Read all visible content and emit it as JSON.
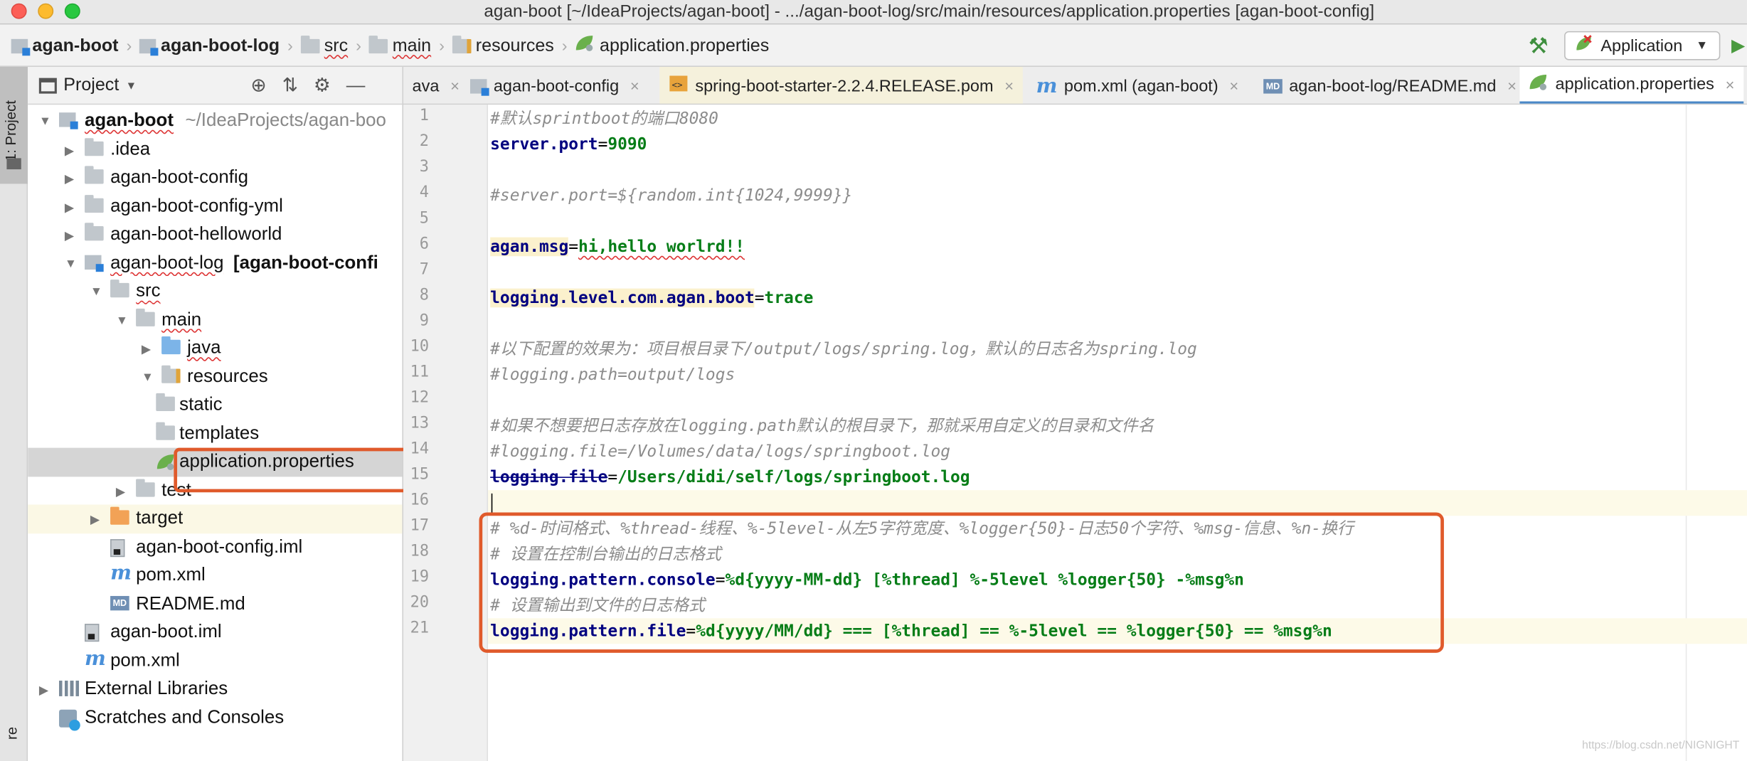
{
  "window": {
    "title": "agan-boot [~/IdeaProjects/agan-boot] - .../agan-boot-log/src/main/resources/application.properties [agan-boot-config]"
  },
  "breadcrumb": [
    {
      "label": "agan-boot",
      "icon": "module-icon"
    },
    {
      "label": "agan-boot-log",
      "icon": "module-icon"
    },
    {
      "label": "src",
      "icon": "folder-icon"
    },
    {
      "label": "main",
      "icon": "folder-icon"
    },
    {
      "label": "resources",
      "icon": "resources-folder-icon"
    },
    {
      "label": "application.properties",
      "icon": "spring-leaf-icon"
    }
  ],
  "toolbar": {
    "run_config_label": "Application"
  },
  "toolstrip": {
    "project_tab_label": "1: Project",
    "bottom_label": "re"
  },
  "project_panel": {
    "title": "Project",
    "tree": [
      {
        "label": "agan-boot",
        "suffix": "~/IdeaProjects/agan-boo",
        "depth": 0,
        "icon": "module-icon",
        "arrow": "down"
      },
      {
        "label": ".idea",
        "depth": 1,
        "icon": "folder-icon",
        "arrow": "right"
      },
      {
        "label": "agan-boot-config",
        "depth": 1,
        "icon": "folder-icon",
        "arrow": "right"
      },
      {
        "label": "agan-boot-config-yml",
        "depth": 1,
        "icon": "folder-icon",
        "arrow": "right"
      },
      {
        "label": "agan-boot-helloworld",
        "depth": 1,
        "icon": "folder-icon",
        "arrow": "right"
      },
      {
        "label": "agan-boot-log",
        "suffix": "[agan-boot-confi",
        "depth": 1,
        "icon": "module-icon",
        "arrow": "down"
      },
      {
        "label": "src",
        "depth": 2,
        "icon": "folder-icon",
        "arrow": "down"
      },
      {
        "label": "main",
        "depth": 3,
        "icon": "folder-icon",
        "arrow": "down"
      },
      {
        "label": "java",
        "depth": 4,
        "icon": "source-folder-icon",
        "arrow": "right"
      },
      {
        "label": "resources",
        "depth": 4,
        "icon": "resources-folder-icon",
        "arrow": "down"
      },
      {
        "label": "static",
        "depth": 5,
        "icon": "folder-icon",
        "arrow": ""
      },
      {
        "label": "templates",
        "depth": 5,
        "icon": "folder-icon",
        "arrow": ""
      },
      {
        "label": "application.properties",
        "depth": 5,
        "icon": "spring-leaf-icon",
        "arrow": ""
      },
      {
        "label": "test",
        "depth": 3,
        "icon": "folder-icon",
        "arrow": "right"
      },
      {
        "label": "target",
        "depth": 2,
        "icon": "excluded-folder-icon",
        "arrow": "right"
      },
      {
        "label": "agan-boot-config.iml",
        "depth": 2,
        "icon": "iml-file-icon",
        "arrow": ""
      },
      {
        "label": "pom.xml",
        "depth": 2,
        "icon": "maven-icon",
        "arrow": ""
      },
      {
        "label": "README.md",
        "depth": 2,
        "icon": "markdown-icon",
        "arrow": ""
      },
      {
        "label": "agan-boot.iml",
        "depth": 1,
        "icon": "iml-file-icon",
        "arrow": ""
      },
      {
        "label": "pom.xml",
        "depth": 1,
        "icon": "maven-icon",
        "arrow": ""
      },
      {
        "label": "External Libraries",
        "depth": 0,
        "icon": "library-icon",
        "arrow": "right"
      },
      {
        "label": "Scratches and Consoles",
        "depth": 0,
        "icon": "scratch-icon",
        "arrow": ""
      }
    ]
  },
  "tabs": [
    {
      "label": "ava",
      "icon": ""
    },
    {
      "label": "agan-boot-config",
      "icon": "module-icon"
    },
    {
      "label": "spring-boot-starter-2.2.4.RELEASE.pom",
      "icon": "xml-file-icon"
    },
    {
      "label": "pom.xml (agan-boot)",
      "icon": "maven-icon"
    },
    {
      "label": "agan-boot-log/README.md",
      "icon": "markdown-icon"
    },
    {
      "label": "application.properties",
      "icon": "spring-leaf-icon",
      "active": true
    }
  ],
  "editor": {
    "line_numbers": [
      "1",
      "2",
      "3",
      "4",
      "5",
      "6",
      "7",
      "8",
      "9",
      "10",
      "11",
      "12",
      "13",
      "14",
      "15",
      "16",
      "17",
      "18",
      "19",
      "20",
      "21"
    ],
    "lines": [
      {
        "comment": "#默认sprintboot的端口8080"
      },
      {
        "key": "server.port",
        "value": "9090"
      },
      {},
      {
        "comment": "#server.port=${random.int{1024,9999}}"
      },
      {},
      {
        "key": "agan.msg",
        "value": "hi,hello worlrd!!",
        "highlight": true
      },
      {},
      {
        "key": "logging.level.com.agan.boot",
        "value": "trace",
        "highlight": true
      },
      {},
      {
        "comment": "#以下配置的效果为：项目根目录下/output/logs/spring.log，默认的日志名为spring.log"
      },
      {
        "comment": "#logging.path=output/logs"
      },
      {},
      {
        "comment": "#如果不想要把日志存放在logging.path默认的根目录下，那就采用自定义的目录和文件名"
      },
      {
        "comment": "#logging.file=/Volumes/data/logs/springboot.log"
      },
      {
        "key": "logging.file",
        "value": "/Users/didi/self/logs/springboot.log",
        "deprecated": true
      },
      {
        "cursor": true
      },
      {
        "comment": "# %d-时间格式、%thread-线程、%-5level-从左5字符宽度、%logger{50}-日志50个字符、%msg-信息、%n-换行"
      },
      {
        "comment": "# 设置在控制台输出的日志格式"
      },
      {
        "key": "logging.pattern.console",
        "value": "%d{yyyy-MM-dd} [%thread] %-5level %logger{50} -%msg%n"
      },
      {
        "comment": "# 设置输出到文件的日志格式"
      },
      {
        "key": "logging.pattern.file",
        "value": "%d{yyyy/MM/dd} === [%thread] == %-5level == %logger{50} == %msg%n",
        "current": true
      }
    ]
  },
  "watermark": "https://blog.csdn.net/NIGNIGHT"
}
